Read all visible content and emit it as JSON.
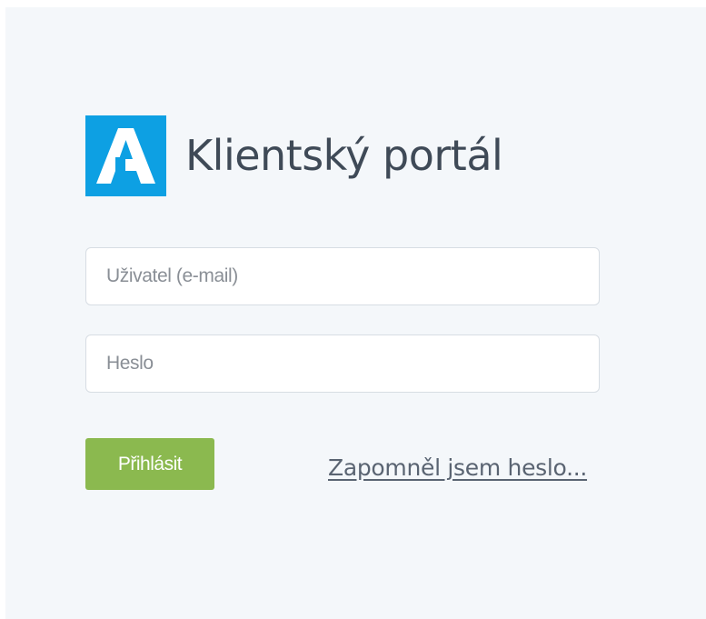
{
  "header": {
    "logo_icon": "letter-a-logo-icon",
    "title": "Klientský portál"
  },
  "form": {
    "user_placeholder": "Uživatel (e-mail)",
    "user_value": "",
    "password_placeholder": "Heslo",
    "password_value": "",
    "login_label": "Přihlásit",
    "forgot_label": "Zapomněl jsem heslo..."
  },
  "colors": {
    "brand_blue": "#0da0e3",
    "login_green": "#8bb94f",
    "title_text": "#3f4a57",
    "link_text": "#5a6472",
    "panel_background": "#f4f7fa"
  }
}
